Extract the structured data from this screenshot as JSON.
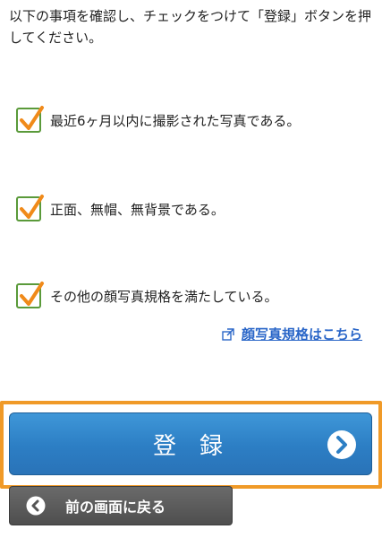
{
  "instruction": "以下の事項を確認し、チェックをつけて「登録」ボタンを押してください。",
  "checklist": [
    {
      "label": "最近6ヶ月以内に撮影された写真である。",
      "checked": true
    },
    {
      "label": "正面、無帽、無背景である。",
      "checked": true
    },
    {
      "label": "その他の顔写真規格を満たしている。",
      "checked": true
    }
  ],
  "spec_link": {
    "label": "顔写真規格はこちら",
    "icon": "external-link-icon"
  },
  "register_button": {
    "label": "登録",
    "icon": "chevron-right-circle-icon",
    "color": "#2c7ec4"
  },
  "back_button": {
    "label": "前の画面に戻る",
    "icon": "chevron-left-circle-icon",
    "color": "#555555"
  },
  "colors": {
    "highlight_frame": "#f09a28",
    "check_mark": "#f08a1a",
    "checkbox_border": "#5a9a3a",
    "link": "#2a66c8"
  }
}
